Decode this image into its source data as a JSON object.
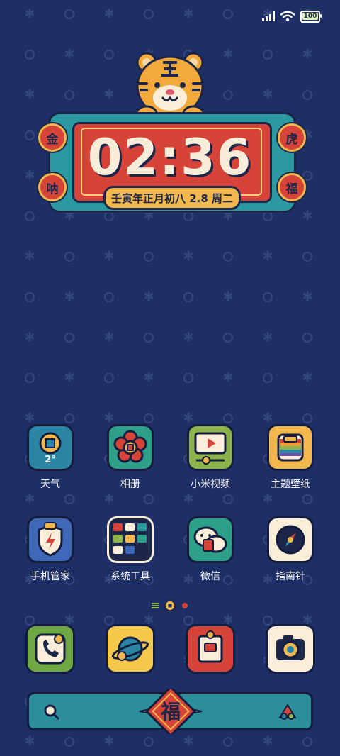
{
  "status_bar": {
    "signal_icon": "cellular-signal-icon",
    "wifi_icon": "wifi-icon",
    "battery_level": "100"
  },
  "clock_widget": {
    "time": "02:36",
    "date_line": "壬寅年正月初八 2.8 周二",
    "seal_top_left": "金",
    "seal_top_right": "虎",
    "seal_bottom_left": "呐",
    "seal_bottom_right": "福",
    "mascot_icon": "tiger-icon"
  },
  "weather_temp": "2°",
  "apps_row1": [
    {
      "label": "天气",
      "icon": "weather-coin-icon"
    },
    {
      "label": "相册",
      "icon": "gallery-flower-icon"
    },
    {
      "label": "小米视频",
      "icon": "video-player-icon"
    },
    {
      "label": "主题壁纸",
      "icon": "themes-rainbow-icon"
    }
  ],
  "apps_row2": [
    {
      "label": "手机管家",
      "icon": "security-shield-icon"
    },
    {
      "label": "系统工具",
      "icon": "tools-folder-icon"
    },
    {
      "label": "微信",
      "icon": "wechat-icon"
    },
    {
      "label": "指南针",
      "icon": "compass-icon"
    }
  ],
  "dock": [
    {
      "icon": "phone-icon"
    },
    {
      "icon": "browser-planet-icon"
    },
    {
      "icon": "messages-envelope-icon"
    },
    {
      "icon": "camera-icon"
    }
  ],
  "search_bar": {
    "center_char": "福",
    "left_icon": "search-icon",
    "right_icon": "assistant-icon"
  },
  "colors": {
    "background": "#1d2f66",
    "red": "#d64339",
    "teal": "#2b9aa0",
    "gold": "#f3b84d",
    "outline": "#141d3d"
  }
}
